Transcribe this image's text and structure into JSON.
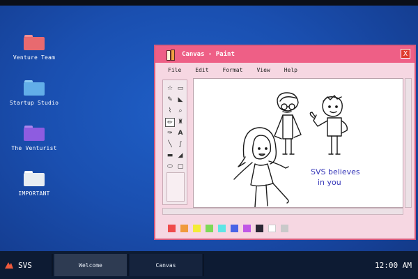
{
  "desktop": {
    "icons": [
      {
        "label": "Venture Team",
        "color": "#e86a6f",
        "tab_color": "#f28d91"
      },
      {
        "label": "Startup Studio",
        "color": "#62aee8",
        "tab_color": "#8ccaf4"
      },
      {
        "label": "The Venturist",
        "color": "#8e5ce0",
        "tab_color": "#ad86ec"
      },
      {
        "label": "IMPORTANT",
        "color": "#e8edf2",
        "tab_color": "#ffffff"
      }
    ]
  },
  "window": {
    "title": "Canvas - Paint",
    "close_label": "X",
    "menu": [
      "File",
      "Edit",
      "Format",
      "View",
      "Help"
    ],
    "tools": [
      {
        "glyph": "☆",
        "name": "free-select-icon"
      },
      {
        "glyph": "▭",
        "name": "rect-select-icon"
      },
      {
        "glyph": "✎",
        "name": "eraser-icon"
      },
      {
        "glyph": "◣",
        "name": "fill-icon"
      },
      {
        "glyph": "⌇",
        "name": "color-picker-icon"
      },
      {
        "glyph": "🔍",
        "name": "magnifier-icon"
      },
      {
        "glyph": "✏",
        "name": "pencil-icon"
      },
      {
        "glyph": "♜",
        "name": "brush-icon"
      },
      {
        "glyph": "✑",
        "name": "airbrush-icon"
      },
      {
        "glyph": "A",
        "name": "text-icon"
      },
      {
        "glyph": "╲",
        "name": "line-icon"
      },
      {
        "glyph": "∫",
        "name": "curve-icon"
      },
      {
        "glyph": "▬",
        "name": "rectangle-icon"
      },
      {
        "glyph": "◢",
        "name": "polygon-icon"
      },
      {
        "glyph": "⬭",
        "name": "ellipse-icon"
      },
      {
        "glyph": "▢",
        "name": "rounded-rect-icon"
      }
    ],
    "canvas_text_line1": "SVS believes",
    "canvas_text_line2": "in you",
    "palette": [
      "#ef4b4b",
      "#f09a3c",
      "#f4ec36",
      "#7ed957",
      "#5ee6e6",
      "#4a63e6",
      "#c157e6",
      "#2b2733",
      "#ffffff",
      "#c9c9c9"
    ]
  },
  "taskbar": {
    "start_label": "SVS",
    "tasks": [
      "Welcome",
      "Canvas"
    ],
    "clock": "12:00 AM"
  }
}
